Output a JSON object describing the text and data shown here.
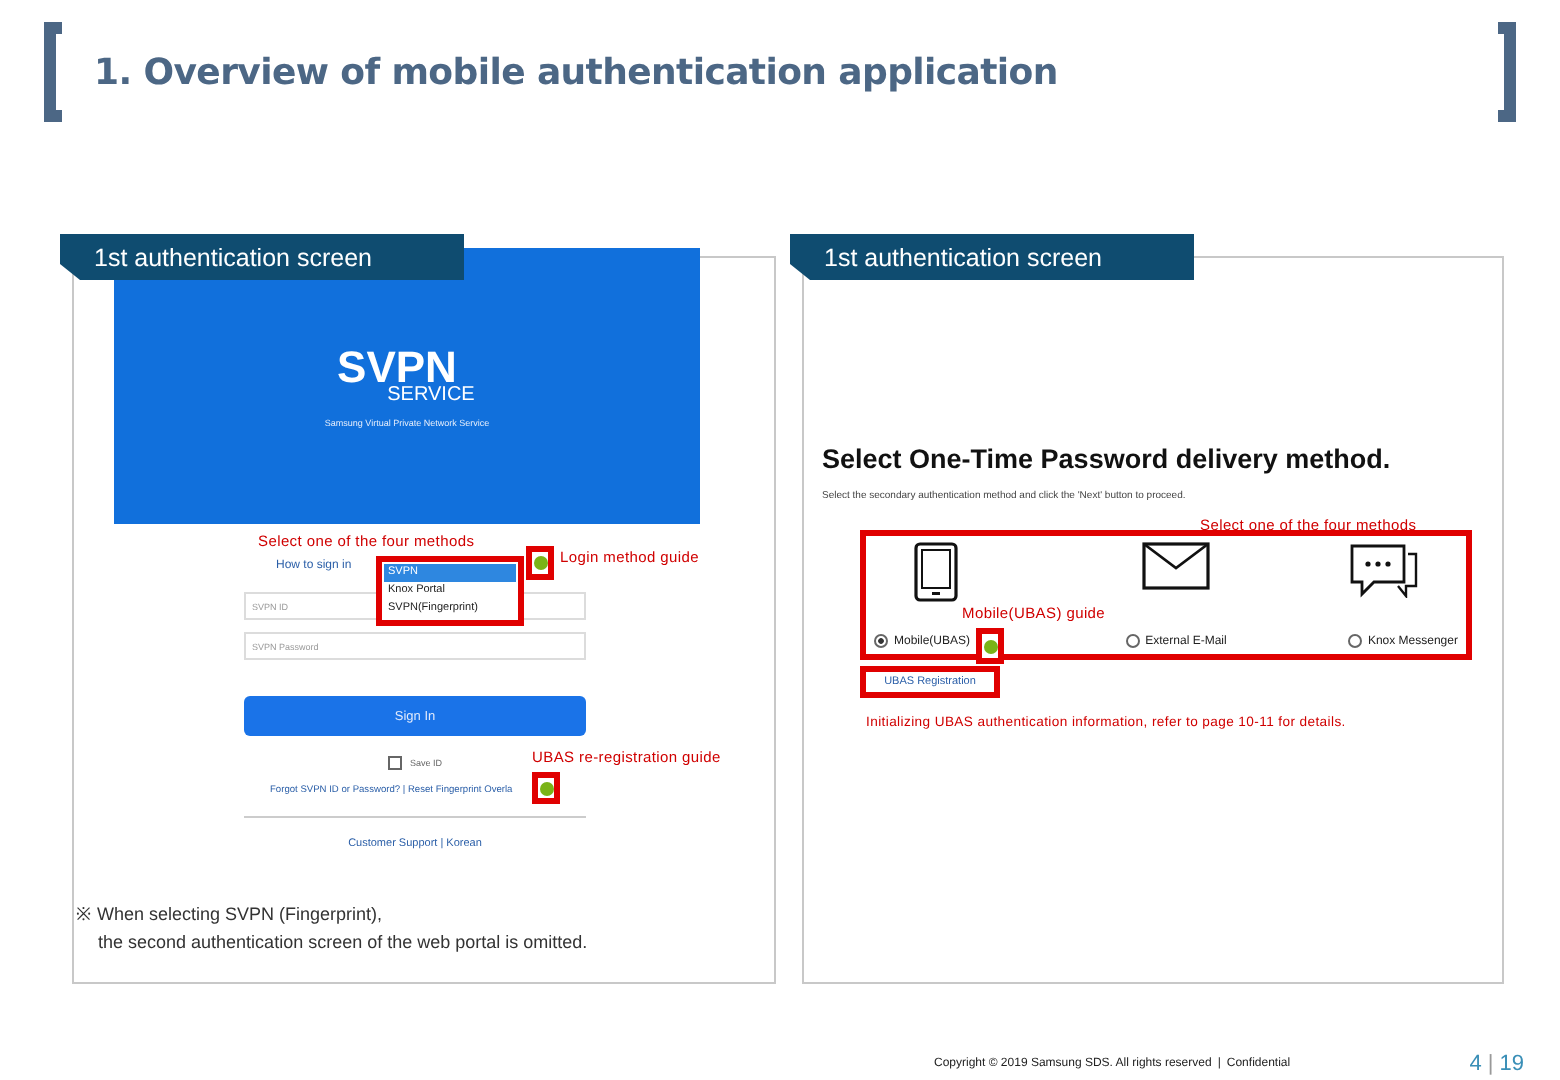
{
  "title": "1. Overview of mobile authentication application",
  "left": {
    "tab": "1st authentication screen",
    "banner": {
      "logo": "SVPN",
      "sub": "SERVICE",
      "tagline": "Samsung Virtual Private Network Service"
    },
    "sign_in_label": "How to sign in",
    "methods": [
      {
        "label": "SVPN",
        "selected": true
      },
      {
        "label": "Knox Portal",
        "selected": false
      },
      {
        "label": "SVPN(Fingerprint)",
        "selected": false
      }
    ],
    "id_placeholder": "SVPN ID",
    "password_placeholder": "SVPN Password",
    "sign_in_button": "Sign In",
    "save_id": {
      "label": "Save ID",
      "checked": false
    },
    "links": "Forgot SVPN ID or Password? | Reset Fingerprint Overla",
    "footer_link": "Customer Support | Korean",
    "annotations": {
      "methods": "Select one of the four methods",
      "login_guide": "Login method guide",
      "ubas_guide": "UBAS re-registration guide"
    },
    "note": [
      "※ When selecting SVPN (Fingerprint),",
      "the second authentication screen of the web portal is omitted."
    ]
  },
  "right": {
    "tab": "1st authentication screen",
    "heading": "Select One-Time Password delivery method.",
    "instruction": "Select the secondary authentication method and click the 'Next' button to proceed.",
    "options": [
      {
        "kind": "phone",
        "label": "Mobile(UBAS)",
        "selected": true
      },
      {
        "kind": "mail",
        "label": "External E-Mail",
        "selected": false
      },
      {
        "kind": "chat",
        "label": "Knox Messenger",
        "selected": false
      }
    ],
    "registration_button": "UBAS Registration",
    "annotations": {
      "methods": "Select one of the four methods",
      "mobile_guide": "Mobile(UBAS) guide",
      "initializing": "Initializing UBAS authentication information, refer to page 10-11 for details."
    }
  },
  "footer": {
    "copyright": "Copyright © 2019 Samsung SDS. All rights reserved",
    "separator": "|",
    "confidential": "Confidential",
    "page": "4",
    "page_separator": "|",
    "total": "19"
  }
}
